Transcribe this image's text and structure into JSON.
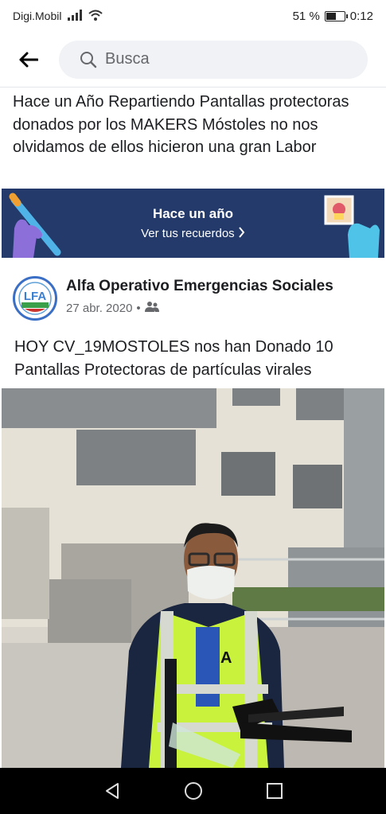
{
  "status_bar": {
    "carrier": "Digi.Mobil",
    "battery": "51 %",
    "battery_level": 0.51,
    "time": "0:12"
  },
  "search": {
    "placeholder": "Busca"
  },
  "share_text": "Hace un Año Repartiendo Pantallas protectoras donados por los MAKERS Móstoles no nos olvidamos de ellos hicieron una gran Labor",
  "memories": {
    "title": "Hace un año",
    "link": "Ver tus recuerdos"
  },
  "post": {
    "author": "Alfa Operativo Emergencias Sociales",
    "date": "27 abr. 2020",
    "separator": "•",
    "audience_icon": "group-icon",
    "avatar_text": "LFA",
    "text": "HOY CV_19MOSTOLES nos han Donado  10 Pantallas Protectoras de partículas virales",
    "vest_logo": "A"
  },
  "icons": {
    "back": "arrow-left-icon",
    "search": "search-icon",
    "nav": [
      "back-triangle-icon",
      "home-circle-icon",
      "recents-square-icon"
    ]
  },
  "colors": {
    "memories_bg": "#233a6b",
    "avatar_ring": "#3a6fc5",
    "vest": "#c8f23c"
  }
}
